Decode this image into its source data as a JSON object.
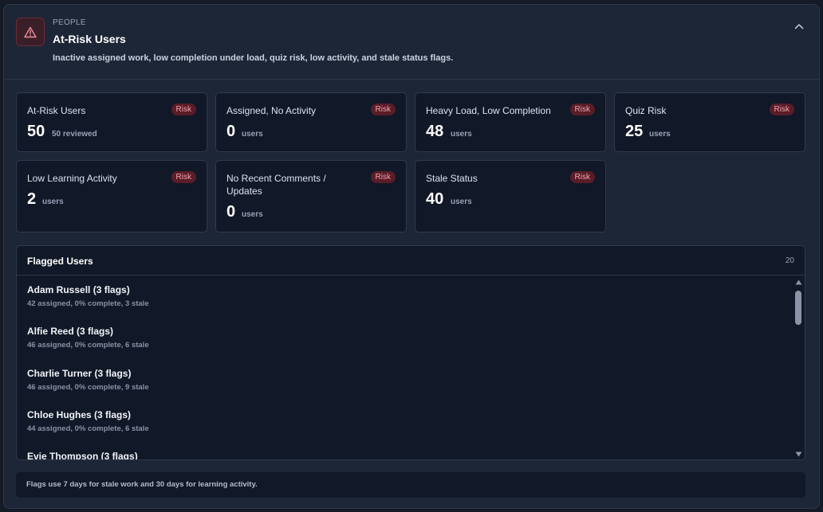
{
  "header": {
    "eyebrow": "PEOPLE",
    "title": "At-Risk Users",
    "subtitle": "Inactive assigned work, low completion under load, quiz risk, low activity, and stale status flags.",
    "icon": "warning-triangle-icon"
  },
  "colors": {
    "background": "#1d2636",
    "card": "#111827",
    "risk_badge_bg": "#5a1d28",
    "risk_badge_text": "#f1a4ae"
  },
  "cards": [
    {
      "label": "At-Risk Users",
      "badge": "Risk",
      "value": "50",
      "unit": "50 reviewed"
    },
    {
      "label": "Assigned, No Activity",
      "badge": "Risk",
      "value": "0",
      "unit": "users"
    },
    {
      "label": "Heavy Load, Low Completion",
      "badge": "Risk",
      "value": "48",
      "unit": "users"
    },
    {
      "label": "Quiz Risk",
      "badge": "Risk",
      "value": "25",
      "unit": "users"
    },
    {
      "label": "Low Learning Activity",
      "badge": "Risk",
      "value": "2",
      "unit": "users"
    },
    {
      "label": "No Recent Comments / Updates",
      "badge": "Risk",
      "value": "0",
      "unit": "users"
    },
    {
      "label": "Stale Status",
      "badge": "Risk",
      "value": "40",
      "unit": "users"
    }
  ],
  "flagged": {
    "title": "Flagged Users",
    "count": "20",
    "items": [
      {
        "name": "Adam Russell (3 flags)",
        "meta": "42 assigned, 0% complete, 3 stale"
      },
      {
        "name": "Alfie Reed (3 flags)",
        "meta": "46 assigned, 0% complete, 6 stale"
      },
      {
        "name": "Charlie Turner (3 flags)",
        "meta": "46 assigned, 0% complete, 9 stale"
      },
      {
        "name": "Chloe Hughes (3 flags)",
        "meta": "44 assigned, 0% complete, 6 stale"
      },
      {
        "name": "Evie Thompson (3 flags)",
        "meta": ""
      }
    ]
  },
  "footer": {
    "note": "Flags use 7 days for stale work and 30 days for learning activity."
  }
}
